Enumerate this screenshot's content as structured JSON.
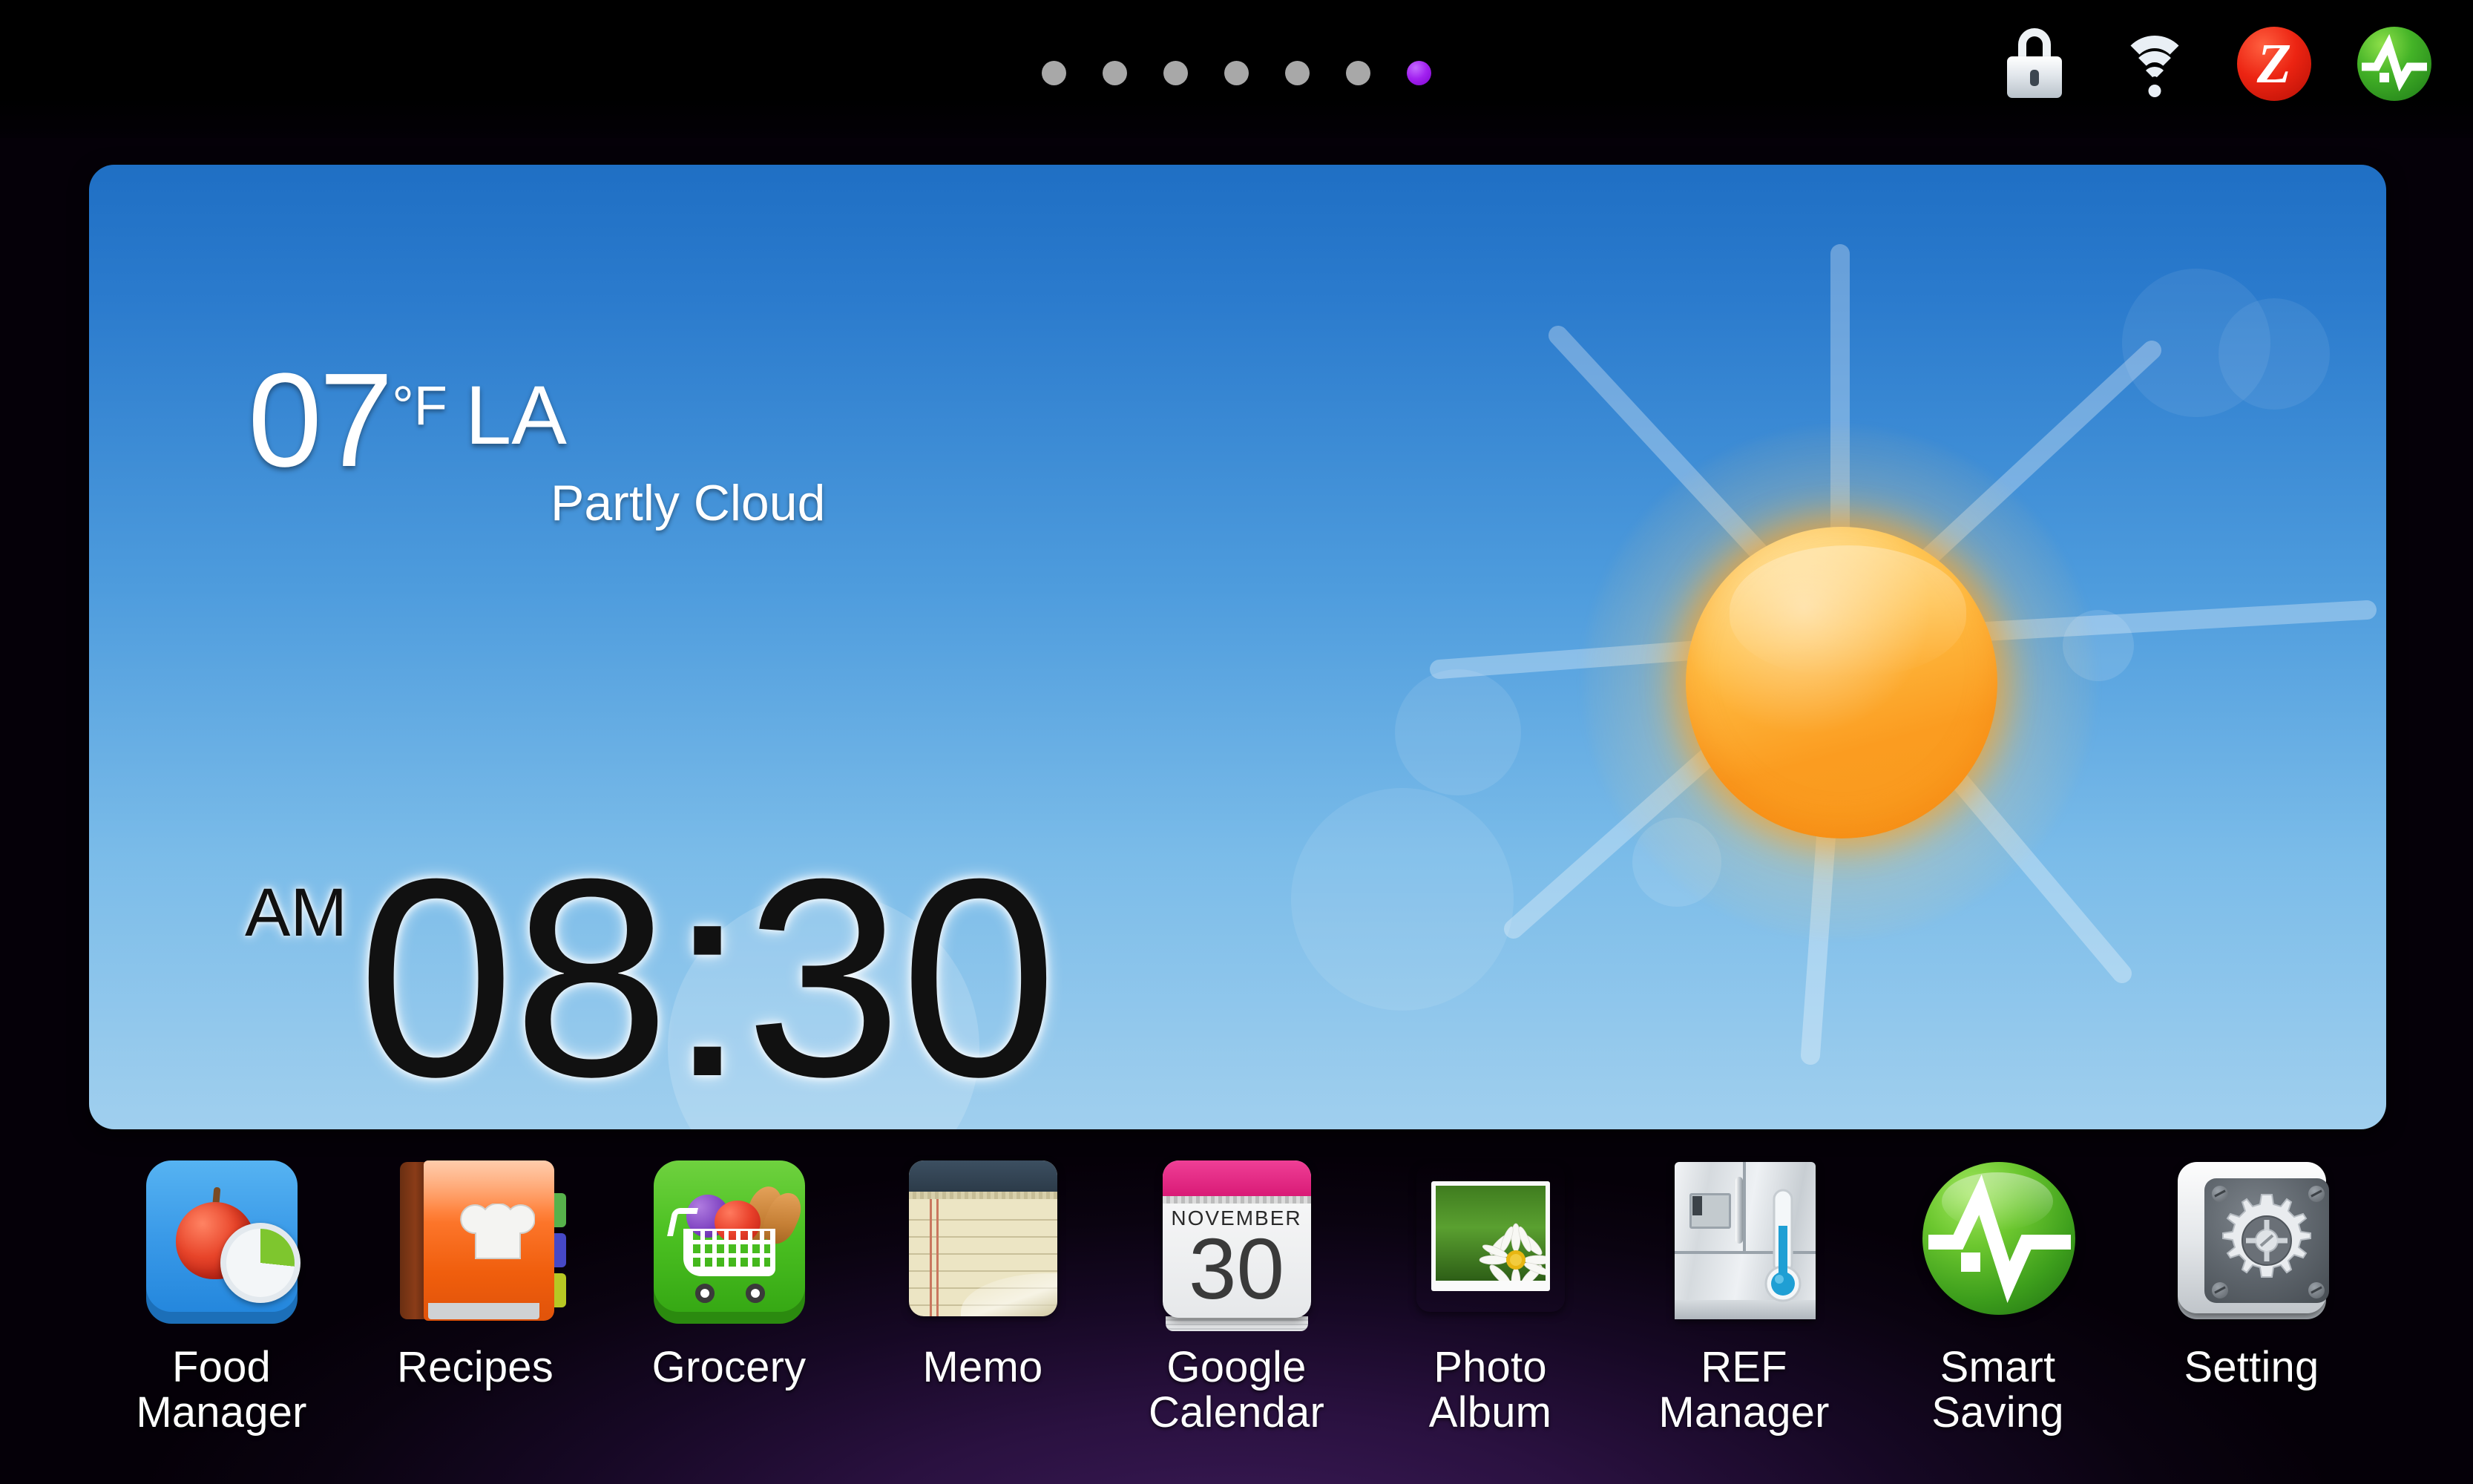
{
  "statusbar": {
    "page_indicator": {
      "total": 7,
      "active_index": 6,
      "dot_color": "#a8a8a8",
      "active_color": "#a221f0"
    },
    "tray_icons": [
      {
        "name": "lock-icon",
        "label": "Screen Lock"
      },
      {
        "name": "wifi-icon",
        "label": "Wi-Fi"
      },
      {
        "name": "zigbee-icon",
        "label": "Z",
        "color": "#ec2412"
      },
      {
        "name": "smart-saving-status-icon",
        "label": "Smart Saving",
        "color": "#44b327"
      }
    ]
  },
  "widget": {
    "weather": {
      "temperature": "07",
      "unit": "°F",
      "city": "LA",
      "condition": "Partly Cloud",
      "icon": "sun-icon",
      "sun_color": "#ffbe45"
    },
    "clock": {
      "meridiem": "AM",
      "time": "08:30",
      "hours": "08",
      "minutes": "30"
    },
    "background_top_color": "#1f6fc4",
    "background_bottom_color": "#a0cfee"
  },
  "dock": {
    "apps": [
      {
        "label": "Food\nManager",
        "line1": "Food",
        "line2": "Manager",
        "icon": "food-manager-icon"
      },
      {
        "label": "Recipes",
        "line1": "Recipes",
        "line2": "",
        "icon": "recipes-icon"
      },
      {
        "label": "Grocery",
        "line1": "Grocery",
        "line2": "",
        "icon": "grocery-icon"
      },
      {
        "label": "Memo",
        "line1": "Memo",
        "line2": "",
        "icon": "memo-icon"
      },
      {
        "label": "Google\nCalendar",
        "line1": "Google",
        "line2": "Calendar",
        "icon": "google-calendar-icon",
        "calendar": {
          "month": "NOVEMBER",
          "day": "30"
        }
      },
      {
        "label": "Photo\nAlbum",
        "line1": "Photo",
        "line2": "Album",
        "icon": "photo-album-icon"
      },
      {
        "label": "REF\nManager",
        "line1": "REF",
        "line2": "Manager",
        "icon": "ref-manager-icon"
      },
      {
        "label": "Smart\nSaving",
        "line1": "Smart",
        "line2": "Saving",
        "icon": "smart-saving-icon"
      },
      {
        "label": "Setting",
        "line1": "Setting",
        "line2": "",
        "icon": "setting-icon"
      }
    ]
  }
}
